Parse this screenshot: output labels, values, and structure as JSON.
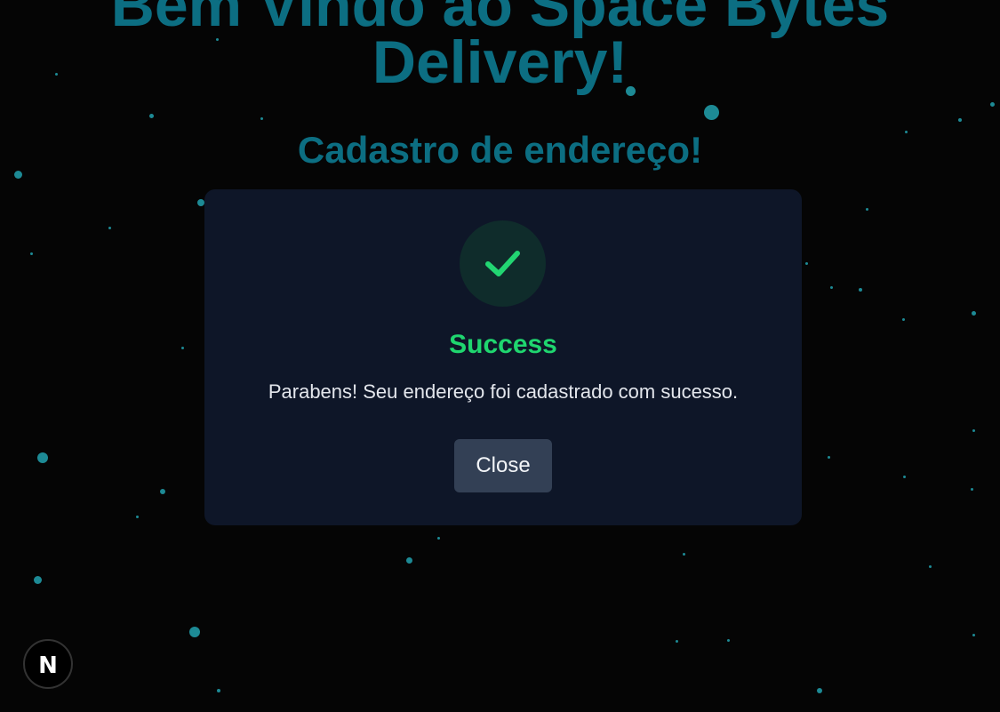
{
  "header": {
    "title": "Bem Vindo ao Space Bytes Delivery!",
    "subtitle": "Cadastro de endereço!"
  },
  "modal": {
    "icon": "check-icon",
    "title": "Success",
    "message": "Parabens! Seu endereço foi cadastrado com sucesso.",
    "close_label": "Close"
  },
  "dev_indicator": {
    "label": "N"
  },
  "colors": {
    "background": "#050505",
    "heading": "#0c6e82",
    "modal_background": "#0e1628",
    "success": "#1fd66f",
    "button_background": "#334055",
    "star": "#1d8a95"
  }
}
